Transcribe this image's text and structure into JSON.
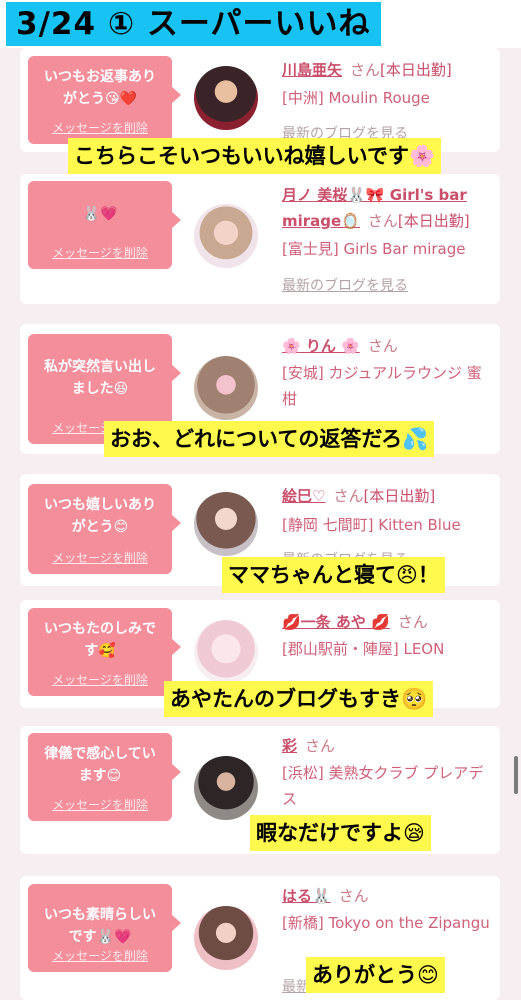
{
  "header": {
    "title": "3/24 ① スーパーいいね"
  },
  "common": {
    "delete_label": "メッセージを削除",
    "blog_label": "最新のブログを見る",
    "san": "さん"
  },
  "cards": [
    {
      "message": "いつもお返事ありがとう😘❤️",
      "name": "川島亜矢",
      "after_san": "[本日出勤]",
      "shop": "[中洲] Moulin Rouge",
      "caption": "こちらこそいつもいいね嬉しいです🌸"
    },
    {
      "message": "🐰💗",
      "name": "月ノ 美桜🐰🎀 Girl's bar mirage🪞",
      "after_san": "[本日出勤]",
      "shop": "[富士見] Girls Bar mirage",
      "caption": ""
    },
    {
      "message": "私が突然言い出しました😆",
      "name": "🌸 りん 🌸",
      "after_san": "",
      "shop": "[安城] カジュアルラウンジ 蜜柑",
      "caption": "おお、どれについての返答だろ💦"
    },
    {
      "message": "いつも嬉しいありがとう😊",
      "name": "絵巳♡",
      "after_san": "[本日出勤]",
      "shop": "[静岡 七間町] Kitten Blue",
      "caption": "ママちゃんと寝て😠！"
    },
    {
      "message": "いつもたのしみです🥰",
      "name": "💋一条 あや 💋",
      "after_san": "",
      "shop": "[郡山駅前・陣屋] LEON",
      "caption": "あやたんのブログもすき🥺"
    },
    {
      "message": "律儀で感心しています😊",
      "name": "彩",
      "after_san": "",
      "shop": "[浜松] 美熟女クラブ プレアデス",
      "caption": "暇なだけですよ😪"
    },
    {
      "message": "いつも素晴らしいです🐰💗",
      "name": "はる🐰",
      "after_san": "",
      "shop": "[新橋] Tokyo on the Zipangu",
      "caption": "ありがとう😊"
    }
  ]
}
